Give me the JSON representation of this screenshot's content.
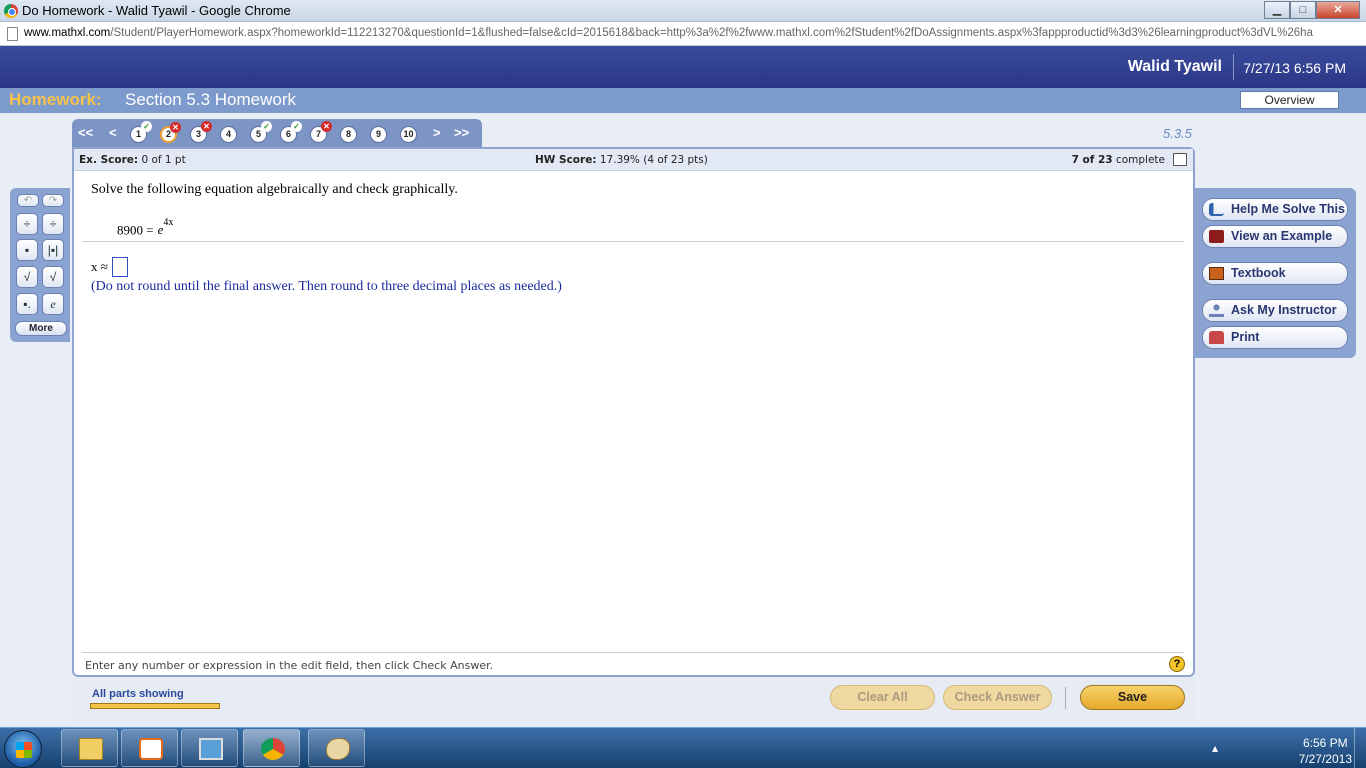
{
  "window": {
    "title": "Do Homework - Walid Tyawil - Google Chrome",
    "minimize": "▁",
    "maximize": "□",
    "close": "✕"
  },
  "address": {
    "host": "www.mathxl.com",
    "path": "/Student/PlayerHomework.aspx?homeworkId=112213270&questionId=1&flushed=false&cId=2015618&back=http%3a%2f%2fwww.mathxl.com%2fStudent%2fDoAssignments.aspx%3fappproductid%3d3%26learningproduct%3dVL%26ha"
  },
  "header": {
    "user_name": "Walid Tyawil",
    "datetime": "7/27/13 6:56 PM"
  },
  "homework": {
    "label": "Homework:",
    "title": "Section 5.3 Homework",
    "overview_button": "Overview"
  },
  "nav": {
    "first": "<<",
    "prev": "<",
    "next": ">",
    "last": ">>",
    "questions": [
      {
        "num": "1",
        "status": "correct",
        "mark": "✓"
      },
      {
        "num": "2",
        "status": "incorrect",
        "mark": "✕",
        "current": true
      },
      {
        "num": "3",
        "status": "incorrect",
        "mark": "✕"
      },
      {
        "num": "4",
        "status": "none",
        "mark": ""
      },
      {
        "num": "5",
        "status": "correct",
        "mark": "✓"
      },
      {
        "num": "6",
        "status": "correct",
        "mark": "✓"
      },
      {
        "num": "7",
        "status": "incorrect",
        "mark": "✕"
      },
      {
        "num": "8",
        "status": "none",
        "mark": ""
      },
      {
        "num": "9",
        "status": "none",
        "mark": ""
      },
      {
        "num": "10",
        "status": "none",
        "mark": ""
      }
    ],
    "question_id": "5.3.5"
  },
  "score": {
    "ex_label": "Ex. Score:",
    "ex_value": "0 of 1 pt",
    "hw_label": "HW Score:",
    "hw_value": "17.39% (4 of 23 pts)",
    "progress_bold": "7 of 23",
    "progress_text": "complete"
  },
  "question": {
    "prompt": "Solve the following equation algebraically and check graphically.",
    "equation_lhs": "8900 =",
    "equation_base": "e",
    "equation_exp": "4x",
    "answer_label": "x ≈",
    "answer_value": "",
    "instruction": "(Do not round until the final answer. Then round to three decimal places as needed.)",
    "hint": "Enter any number or expression in the edit field, then click Check Answer.",
    "help_icon": "?"
  },
  "palette": {
    "undo": "↶",
    "redo": "↷",
    "buttons": [
      "÷",
      "÷",
      "▪",
      "|▪|",
      "√",
      "√",
      "▪.",
      "e"
    ],
    "more": "More"
  },
  "tools": [
    {
      "label": "Help Me Solve This",
      "icon": "key-icon"
    },
    {
      "label": "View an Example",
      "icon": "example-icon"
    },
    {
      "label": "Textbook",
      "icon": "book-icon"
    },
    {
      "label": "Ask My Instructor",
      "icon": "instructor-icon"
    },
    {
      "label": "Print",
      "icon": "print-icon"
    }
  ],
  "actions": {
    "parts": "All parts showing",
    "clear_all": "Clear All",
    "check_answer": "Check Answer",
    "save": "Save"
  },
  "taskbar": {
    "time": "6:56 PM",
    "date": "7/27/2013",
    "tray": "▴"
  }
}
